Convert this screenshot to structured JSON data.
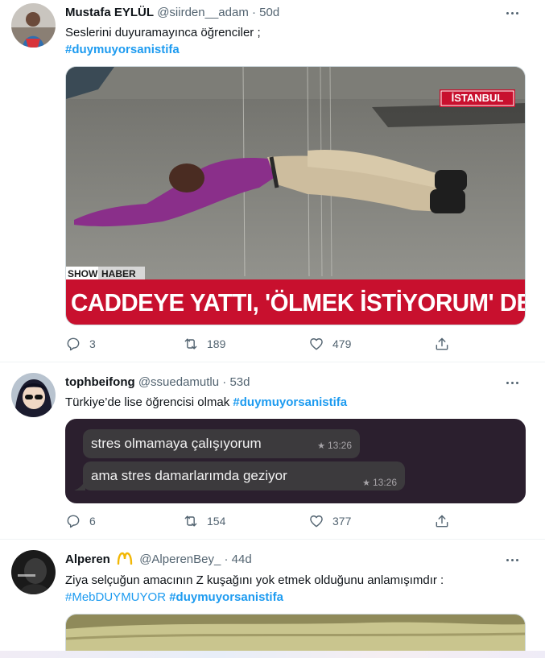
{
  "tweets": [
    {
      "name": "Mustafa EYLÜL",
      "handle": "@siirden__adam",
      "separator": "·",
      "time": "50d",
      "text": "Seslerini duyuramayınca öğrenciler ;",
      "hashtags": [
        "#duymuyorsanistifa"
      ],
      "media": {
        "type": "news-image",
        "corner_label": "İSTANBUL",
        "brand_show": "SHOW",
        "brand_haber": "HABER",
        "headline": "CADDEYE YATTI, 'ÖLMEK İSTİYORUM' DEDİ"
      },
      "replies": "3",
      "retweets": "189",
      "likes": "479"
    },
    {
      "name": "tophbeifong",
      "handle": "@ssuedamutlu",
      "separator": "·",
      "time": "53d",
      "text": "Türkiye’de lise öğrencisi olmak",
      "hashtags": [
        "#duymuyorsanistifa"
      ],
      "media": {
        "type": "chat-screenshot",
        "messages": [
          {
            "text": "stres olmamaya çalışıyorum",
            "time": "13:26"
          },
          {
            "text": "ama stres damarlarımda geziyor",
            "time": "13:26"
          }
        ]
      },
      "replies": "6",
      "retweets": "154",
      "likes": "377"
    },
    {
      "name": "Alperen",
      "name_badge_icon": "gold-m-arches-icon",
      "handle": "@AlperenBey_",
      "separator": "·",
      "time": "44d",
      "text": "Ziya selçuğun amacının Z kuşağını yok etmek olduğunu anlamışımdır :",
      "hashtags": [
        "#MebDUYMUYOR",
        "#duymuyorsanistifa"
      ]
    }
  ],
  "colors": {
    "link": "#1d9bf0",
    "secondary_text": "#536471",
    "chat_background": "#2b1f2e",
    "chat_bubble": "#3c3a3d",
    "news_banner": "#c8102e"
  }
}
